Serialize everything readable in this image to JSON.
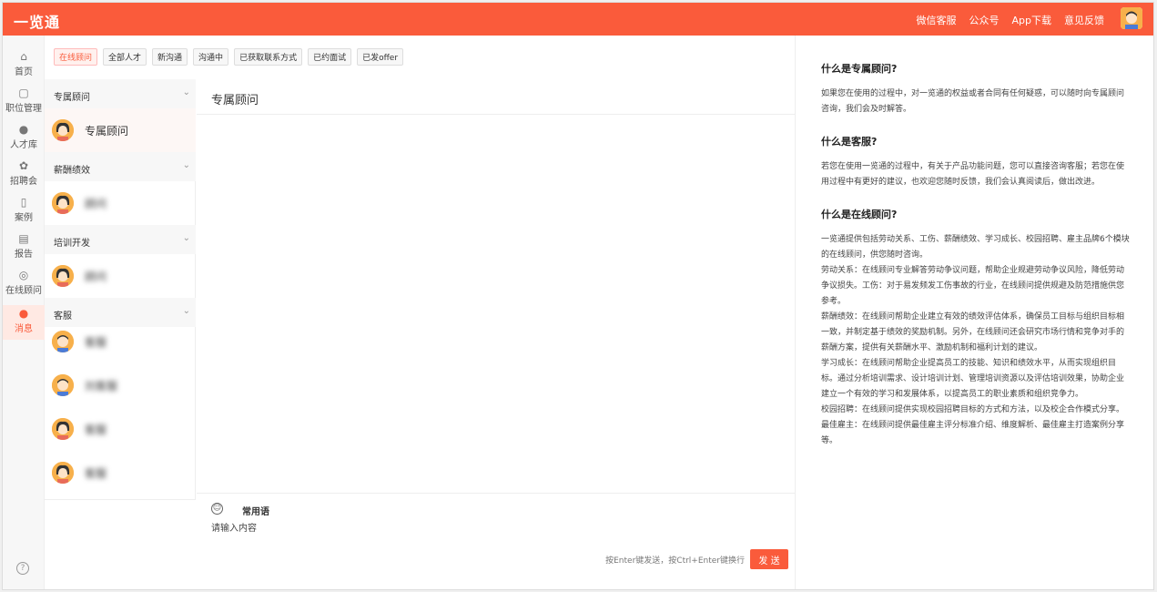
{
  "app": {
    "brand": "一览通"
  },
  "topnav": [
    "微信客服",
    "公众号",
    "App下载",
    "意见反馈"
  ],
  "leftnav": [
    {
      "label": "首页",
      "icon": "home-icon",
      "glyph": "⌂",
      "active": false
    },
    {
      "label": "职位管理",
      "icon": "briefcase-icon",
      "glyph": "▢",
      "active": false
    },
    {
      "label": "人才库",
      "icon": "user-icon",
      "glyph": "●",
      "active": false
    },
    {
      "label": "招聘会",
      "icon": "fair-icon",
      "glyph": "✿",
      "active": false
    },
    {
      "label": "案例",
      "icon": "book-icon",
      "glyph": "▯",
      "active": false
    },
    {
      "label": "报告",
      "icon": "report-icon",
      "glyph": "▤",
      "active": false
    },
    {
      "label": "在线顾问",
      "icon": "advisor-icon",
      "glyph": "◎",
      "active": false
    },
    {
      "label": "消息",
      "icon": "message-icon",
      "glyph": "●",
      "active": true
    }
  ],
  "help_icon": "?",
  "tags": [
    "在线顾问",
    "全部人才",
    "新沟通",
    "沟通中",
    "已获取联系方式",
    "已约面试",
    "已发offer"
  ],
  "groups": [
    {
      "title": "专属顾问",
      "contacts": [
        {
          "name": "专属顾问",
          "avatar": "female",
          "selected": true,
          "blurred": false
        }
      ]
    },
    {
      "title": "薪酬绩效",
      "contacts": [
        {
          "name": "顾问",
          "avatar": "female",
          "selected": false,
          "blurred": true
        }
      ]
    },
    {
      "title": "培训开发",
      "contacts": [
        {
          "name": "顾问",
          "avatar": "female",
          "selected": false,
          "blurred": true
        }
      ]
    },
    {
      "title": "客服",
      "contacts": [
        {
          "name": "客服",
          "avatar": "male",
          "selected": false,
          "blurred": true
        },
        {
          "name": "刘客服",
          "avatar": "male",
          "selected": false,
          "blurred": true
        },
        {
          "name": "客服",
          "avatar": "female",
          "selected": false,
          "blurred": true
        },
        {
          "name": "客服",
          "avatar": "female",
          "selected": false,
          "blurred": true
        }
      ]
    }
  ],
  "chat": {
    "title": "专属顾问",
    "phrases_label": "常用语",
    "input_placeholder": "请输入内容",
    "hint": "按Enter键发送，按Ctrl+Enter键换行",
    "send_label": "发 送"
  },
  "faq": [
    {
      "q": "什么是专属顾问?",
      "a": [
        "如果您在使用的过程中，对一览通的权益或者合同有任何疑惑，可以随时向专属顾问咨询，我们会及时解答。"
      ]
    },
    {
      "q": "什么是客服?",
      "a": [
        "若您在使用一览通的过程中，有关于产品功能问题，您可以直接咨询客服；若您在使用过程中有更好的建议，也欢迎您随时反馈，我们会认真阅读后，做出改进。"
      ]
    },
    {
      "q": "什么是在线顾问?",
      "a": [
        "一览通提供包括劳动关系、工伤、薪酬绩效、学习成长、校园招聘、雇主品牌6个模块的在线顾问，供您随时咨询。",
        "劳动关系：在线顾问专业解答劳动争议问题，帮助企业规避劳动争议风险，降低劳动争议损失。工伤：对于易发频发工伤事故的行业，在线顾问提供规避及防范措施供您参考。",
        "薪酬绩效：在线顾问帮助企业建立有效的绩效评估体系，确保员工目标与组织目标相一致，并制定基于绩效的奖励机制。另外，在线顾问还会研究市场行情和竞争对手的薪酬方案，提供有关薪酬水平、激励机制和福利计划的建议。",
        "学习成长：在线顾问帮助企业提高员工的技能、知识和绩效水平，从而实现组织目标。通过分析培训需求、设计培训计划、管理培训资源以及评估培训效果，协助企业建立一个有效的学习和发展体系，以提高员工的职业素质和组织竞争力。",
        "校园招聘：在线顾问提供实现校园招聘目标的方式和方法，以及校企合作模式分享。",
        "最佳雇主：在线顾问提供最佳雇主评分标准介绍、维度解析、最佳雇主打造案例分享等。"
      ]
    }
  ],
  "colors": {
    "brand": "#fa5b3b",
    "avatar_bg": "#f7b04b"
  }
}
